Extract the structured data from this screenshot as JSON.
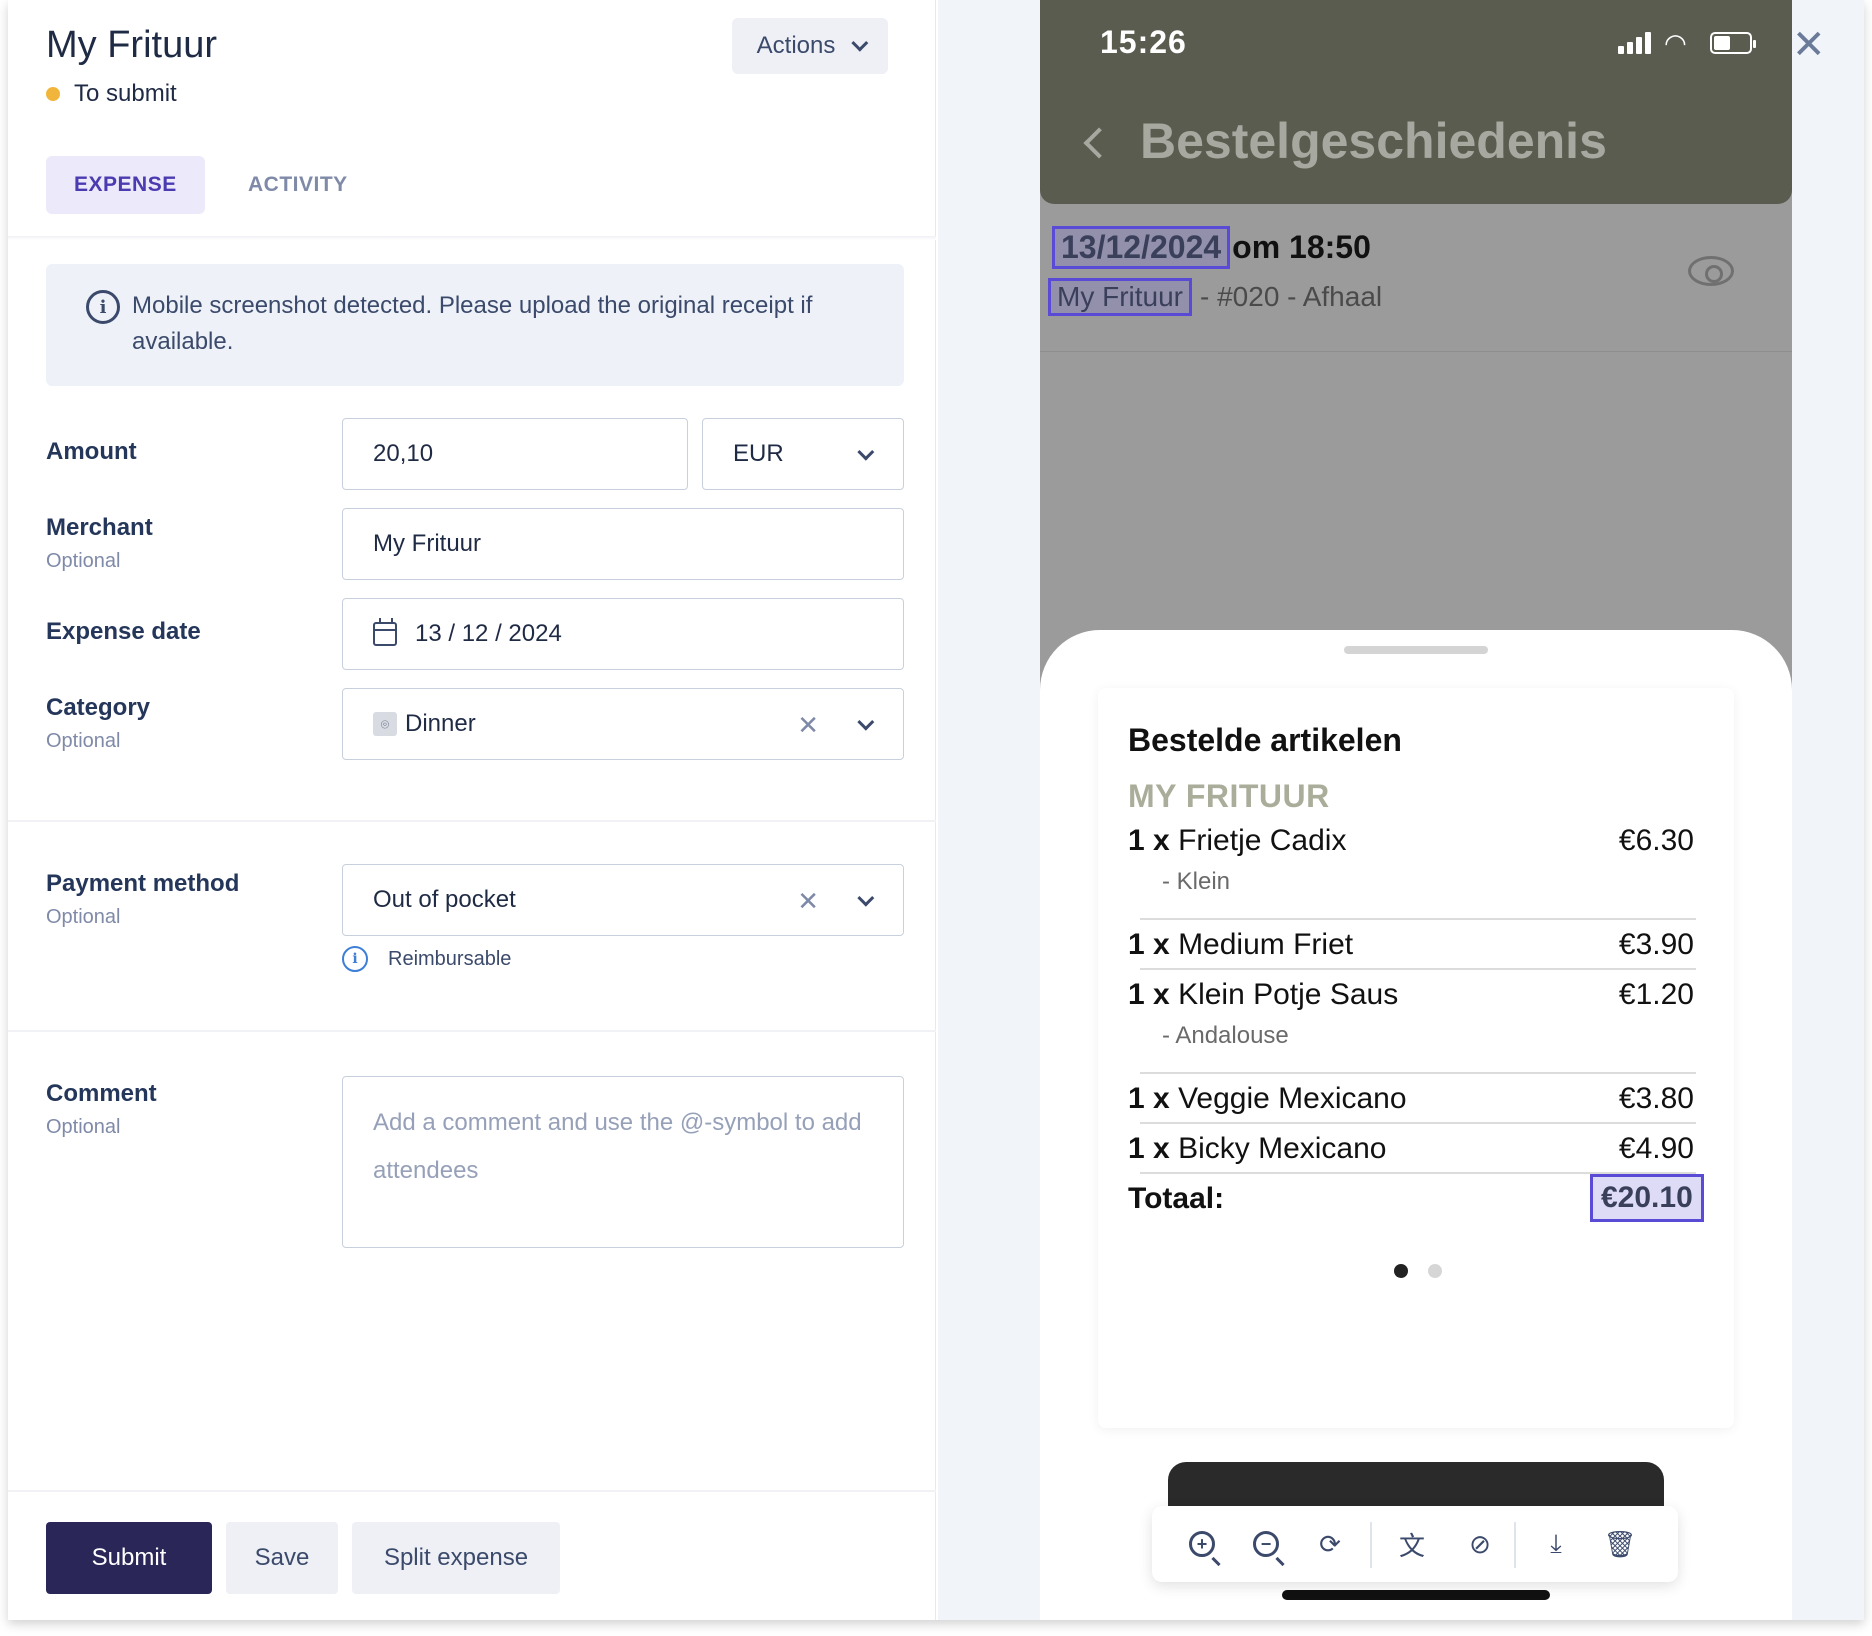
{
  "form": {
    "title": "My Frituur",
    "status": "To submit",
    "actions_label": "Actions",
    "tabs": [
      {
        "label": "EXPENSE",
        "active": true
      },
      {
        "label": "ACTIVITY",
        "active": false
      }
    ],
    "notice": "Mobile screenshot detected. Please upload the original receipt if available.",
    "amount": {
      "label": "Amount",
      "value": "20,10",
      "currency": "EUR"
    },
    "merchant": {
      "label": "Merchant",
      "sublabel": "Optional",
      "value": "My Frituur"
    },
    "expense_date": {
      "label": "Expense date",
      "value": "13 / 12 / 2024"
    },
    "category": {
      "label": "Category",
      "sublabel": "Optional",
      "value": "Dinner"
    },
    "payment_method": {
      "label": "Payment method",
      "sublabel": "Optional",
      "value": "Out of pocket",
      "hint": "Reimbursable"
    },
    "comment": {
      "label": "Comment",
      "sublabel": "Optional",
      "placeholder": "Add a comment and use the @-symbol to add attendees"
    },
    "buttons": {
      "submit": "Submit",
      "save": "Save",
      "split": "Split expense"
    }
  },
  "receipt": {
    "clock": "15:26",
    "title": "Bestelgeschiedenis",
    "order": {
      "date": "13/12/2024",
      "time_suffix": "om 18:50",
      "merchant": "My Frituur",
      "order_suffix": "- #020 - Afhaal"
    },
    "card_title": "Bestelde artikelen",
    "card_subtitle": "MY FRITUUR",
    "items": [
      {
        "qty": "1 x",
        "name": "Frietje Cadix",
        "price": "€6.30",
        "modifier": "- Klein"
      },
      {
        "qty": "1 x",
        "name": "Medium Friet",
        "price": "€3.90",
        "modifier": ""
      },
      {
        "qty": "1 x",
        "name": "Klein Potje Saus",
        "price": "€1.20",
        "modifier": "- Andalouse"
      },
      {
        "qty": "1 x",
        "name": "Veggie Mexicano",
        "price": "€3.80",
        "modifier": ""
      },
      {
        "qty": "1 x",
        "name": "Bicky Mexicano",
        "price": "€4.90",
        "modifier": ""
      }
    ],
    "total_label": "Totaal:",
    "total_value": "€20.10"
  },
  "colors": {
    "primary": "#2a2657",
    "accent": "#4b3bb0",
    "status_dot": "#f1b53c",
    "highlight": "#5a4bd6"
  },
  "icons": [
    "chevron-down-icon",
    "info-icon",
    "calendar-icon",
    "plate-icon",
    "clear-icon",
    "close-icon",
    "eye-icon",
    "zoom-in-icon",
    "zoom-out-icon",
    "rotate-icon",
    "translate-icon",
    "hide-icon",
    "download-icon",
    "trash-icon"
  ]
}
